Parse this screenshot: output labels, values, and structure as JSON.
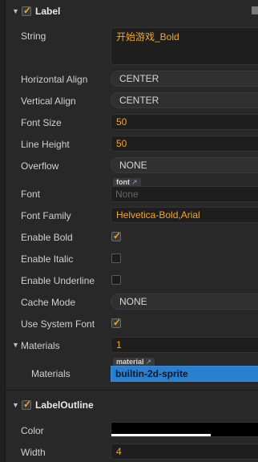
{
  "label_section": {
    "title": "Label",
    "enabled": true,
    "props": {
      "string": {
        "label": "String",
        "value": "开始游戏_Bold"
      },
      "horizontal_align": {
        "label": "Horizontal Align",
        "value": "CENTER"
      },
      "vertical_align": {
        "label": "Vertical Align",
        "value": "CENTER"
      },
      "font_size": {
        "label": "Font Size",
        "value": "50"
      },
      "line_height": {
        "label": "Line Height",
        "value": "50"
      },
      "overflow": {
        "label": "Overflow",
        "value": "NONE"
      },
      "font": {
        "label": "Font",
        "tag": "font",
        "value": "None"
      },
      "font_family": {
        "label": "Font Family",
        "value": "Helvetica-Bold,Arial"
      },
      "enable_bold": {
        "label": "Enable Bold",
        "checked": true
      },
      "enable_italic": {
        "label": "Enable Italic",
        "checked": false
      },
      "enable_underline": {
        "label": "Enable Underline",
        "checked": false
      },
      "cache_mode": {
        "label": "Cache Mode",
        "value": "NONE"
      },
      "use_system_font": {
        "label": "Use System Font",
        "checked": true
      },
      "materials": {
        "label": "Materials",
        "count": "1"
      },
      "materials_item": {
        "label": "Materials",
        "tag": "material",
        "value": "builtin-2d-sprite"
      }
    }
  },
  "outline_section": {
    "title": "LabelOutline",
    "enabled": true,
    "props": {
      "color": {
        "label": "Color",
        "value_hex": "#000000"
      },
      "width": {
        "label": "Width",
        "value": "4"
      }
    }
  },
  "icons": {
    "collapse": "collapse-triangle-icon",
    "check": "checkmark-icon",
    "external_link": "external-link-icon",
    "menu": "component-menu-icon"
  },
  "colors": {
    "accent": "#f5a623",
    "selection": "#2b7fcf",
    "background": "#282828"
  }
}
